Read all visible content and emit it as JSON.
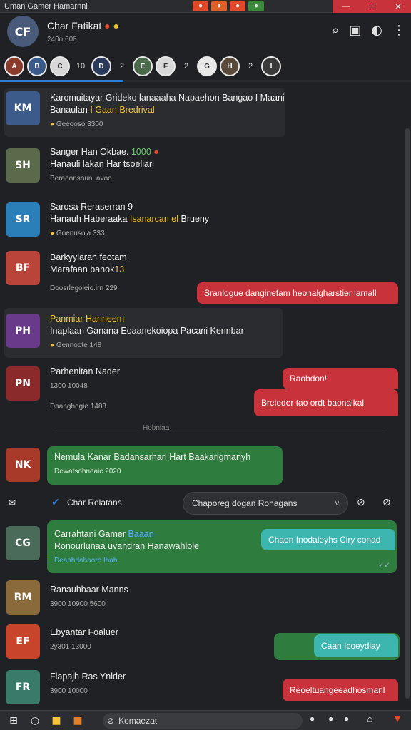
{
  "window": {
    "title": "Uman Gamer Hamarnni"
  },
  "header": {
    "title": "Char Fatikat",
    "subtitle": "240o 608",
    "avatar_initial": "CF"
  },
  "stories": {
    "numbers": [
      "10",
      "2",
      "2",
      "2"
    ],
    "progress_percent": 30
  },
  "messages": [
    {
      "name": "Karomuitayar Grideko lanaaaha Napaehon Bangao I Maani",
      "body": "Banaulan",
      "body_gold": "I Gaan",
      "body_gold2": "Bredrival",
      "meta": "Geeooso",
      "meta2": "3300",
      "initials": "KM",
      "color": "#3c5a8a"
    },
    {
      "name": "Sanger Han Okbae.",
      "name_gold": "1000",
      "body": "Hanauli lakan Har tsoeliari",
      "meta": "Beraeonsoun .avoo",
      "initials": "SH",
      "color": "#5a6a4a"
    },
    {
      "name": "Sarosa Reraserran  9",
      "body": "Hanauh Haberaaka",
      "body_gold": "Isanarcan el",
      "body2": "Brueny",
      "meta": "Goenusola 333",
      "initials": "SR",
      "color": "#2a7fb8"
    },
    {
      "name": "Barkyyiaran feotam",
      "body": "Marafaan banok",
      "body_gold": "13",
      "meta": "Doosrlegoleio.irn 229",
      "initials": "BF",
      "color": "#b8443a"
    },
    {
      "name": "Panmiar Hanneem",
      "body": "Inaplaan Ganana Eoaanekoiopa Pacani Kennbar",
      "meta": "Gennoote 148",
      "initials": "PH",
      "color": "#6a3a8a"
    },
    {
      "name": "Parhenitan Nader",
      "meta": "1300",
      "meta2": "10048",
      "meta3": "Daanghogie 1488",
      "initials": "PN",
      "color": "#8a2a2a"
    },
    {
      "name": "Nemula Kanar Badansarharl Hart Baakarigmanyh",
      "meta": "Dewatsobneaic 2020",
      "initials": "NK",
      "color": "#a83a2a"
    },
    {
      "name": "Carrahtani Gamer",
      "name_blue": "Baaan",
      "body": "Ronourlunaa uvandran Hanawahlole",
      "meta": "Deaahdahaore Ihab",
      "initials": "CG",
      "color": "#4a6a5a"
    },
    {
      "name": "Ranauhbaar Manns",
      "meta": "3900",
      "meta2": "10900",
      "meta3": "5600",
      "initials": "RM",
      "color": "#8a6a3a"
    },
    {
      "name": "Ebyantar Foaluer",
      "meta": "2y301",
      "meta2": "13000",
      "initials": "EF",
      "color": "#c8442a"
    },
    {
      "name": "Flapajh Ras Ynlder",
      "meta": "3900",
      "meta2": "10000",
      "initials": "FR",
      "color": "#3a7a6a"
    }
  ],
  "bubbles": [
    {
      "text": "Sranlogue danginefam heonalgharstier lamall"
    },
    {
      "text": "Raobdon!"
    },
    {
      "text": "Breieder tao ordt baonalkal"
    },
    {
      "text": "Chaon Inodaleyhs Clry conad"
    },
    {
      "text": "Caan Icoeydiay"
    },
    {
      "text": "Reoeltuangeeadhosmanl"
    }
  ],
  "divider": {
    "label": "Hobniaa"
  },
  "section": {
    "label": "Char Relatans",
    "select_value": "Chaporeg dogan Rohagans"
  },
  "taskbar": {
    "search_text": "Kemaezat"
  }
}
